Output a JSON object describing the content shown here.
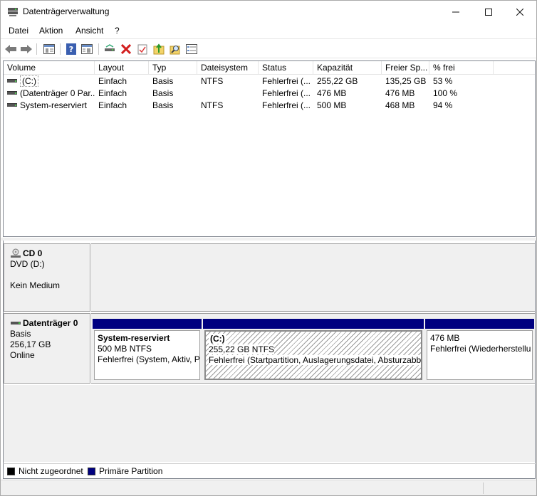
{
  "window": {
    "title": "Datenträgerverwaltung"
  },
  "menu": [
    {
      "label": "Datei"
    },
    {
      "label": "Aktion"
    },
    {
      "label": "Ansicht"
    },
    {
      "label": "?"
    }
  ],
  "toolbar": {
    "icons": [
      "back-icon",
      "forward-icon",
      "console-tree-icon",
      "help-icon",
      "properties-view-icon",
      "connect-disk-icon",
      "delete-icon",
      "checklist-icon",
      "export-icon",
      "search-icon",
      "settings-list-icon"
    ]
  },
  "volume_table": {
    "columns": [
      "Volume",
      "Layout",
      "Typ",
      "Dateisystem",
      "Status",
      "Kapazität",
      "Freier Sp...",
      "% frei"
    ],
    "rows": [
      {
        "volume": "(C:)",
        "layout": "Einfach",
        "typ": "Basis",
        "dateisystem": "NTFS",
        "status": "Fehlerfrei (...",
        "kapazitaet": "255,22 GB",
        "frei": "135,25 GB",
        "prozent": "53 %"
      },
      {
        "volume": "(Datenträger 0 Par...",
        "layout": "Einfach",
        "typ": "Basis",
        "dateisystem": "",
        "status": "Fehlerfrei (...",
        "kapazitaet": "476 MB",
        "frei": "476 MB",
        "prozent": "100 %"
      },
      {
        "volume": "System-reserviert",
        "layout": "Einfach",
        "typ": "Basis",
        "dateisystem": "NTFS",
        "status": "Fehlerfrei (...",
        "kapazitaet": "500 MB",
        "frei": "468 MB",
        "prozent": "94 %"
      }
    ]
  },
  "cd0": {
    "name": "CD 0",
    "drive": "DVD (D:)",
    "media": "Kein Medium"
  },
  "disk0": {
    "name": "Datenträger 0",
    "type": "Basis",
    "size": "256,17 GB",
    "state": "Online",
    "partitions": [
      {
        "name": "System-reserviert",
        "size": "500 MB NTFS",
        "status": "Fehlerfrei (System, Aktiv, P"
      },
      {
        "name": "(C:)",
        "size": "255,22 GB NTFS",
        "status": "Fehlerfrei (Startpartition, Auslagerungsdatei, Absturzabb"
      },
      {
        "name": "",
        "size": "476 MB",
        "status": "Fehlerfrei (Wiederherstellu"
      }
    ]
  },
  "legend": [
    {
      "label": "Nicht zugeordnet",
      "color": "#000000"
    },
    {
      "label": "Primäre Partition",
      "color": "#000080"
    }
  ],
  "colors": {
    "partition_bar": "#000080",
    "background": "#f0f0f0"
  }
}
